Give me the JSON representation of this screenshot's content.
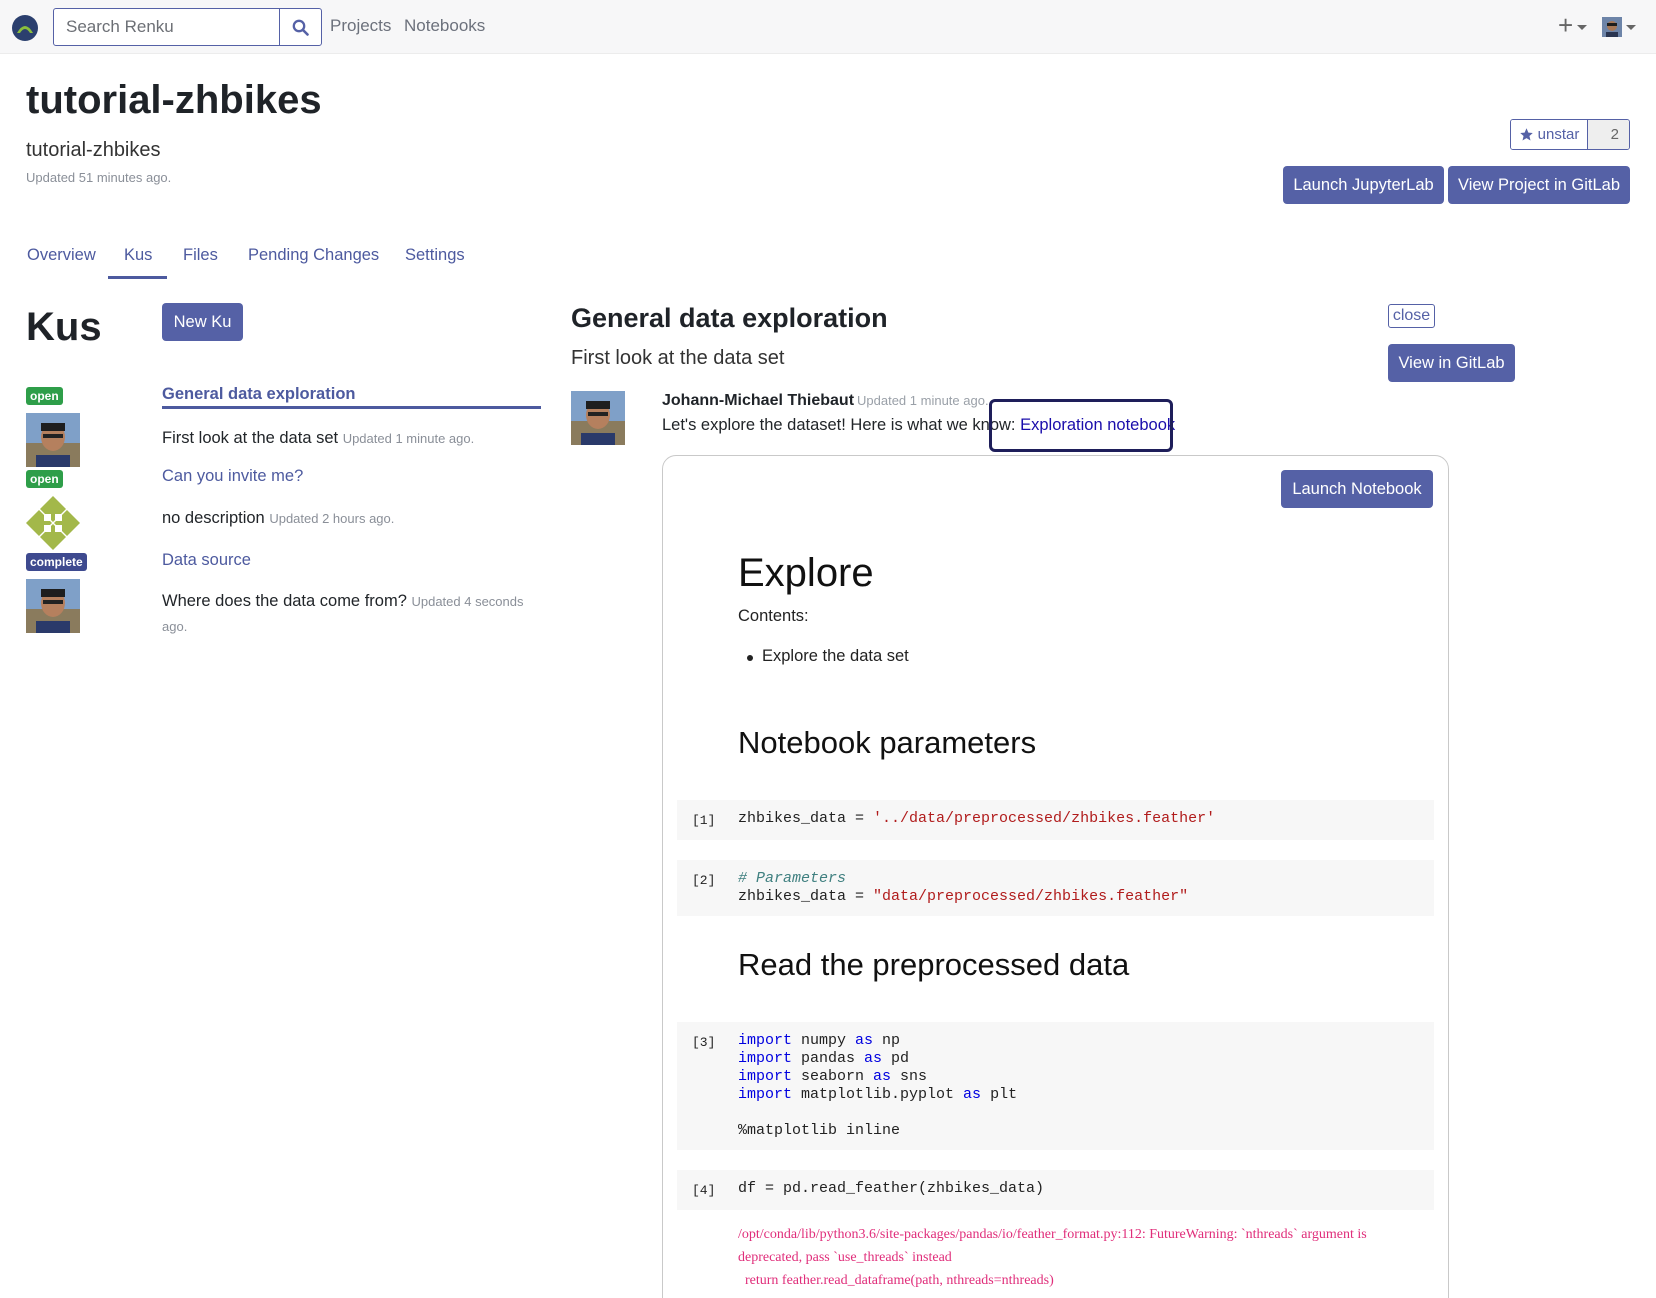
{
  "nav": {
    "search_placeholder": "Search Renku",
    "links": [
      "Projects",
      "Notebooks"
    ],
    "plus_label": "+"
  },
  "project": {
    "title": "tutorial-zhbikes",
    "subtitle": "tutorial-zhbikes",
    "updated": "Updated 51 minutes ago.",
    "star_label": "unstar",
    "star_count": "2",
    "launch_jupyterlab": "Launch JupyterLab",
    "view_in_gitlab": "View Project in GitLab"
  },
  "tabs": [
    "Overview",
    "Kus",
    "Files",
    "Pending Changes",
    "Settings"
  ],
  "kus": {
    "heading": "Kus",
    "new_button": "New Ku",
    "items": [
      {
        "status": "open",
        "title": "General data exploration",
        "desc": "First look at the data set",
        "updated": "Updated 1 minute ago."
      },
      {
        "status": "open",
        "title": "Can you invite me?",
        "desc": "no description",
        "updated": "Updated 2 hours ago."
      },
      {
        "status": "complete",
        "title": "Data source",
        "desc": "Where does the data come from?",
        "updated": "Updated 4 seconds ago."
      }
    ]
  },
  "detail": {
    "title": "General data exploration",
    "subtitle": "First look at the data set",
    "close_label": "close",
    "view_gitlab": "View in GitLab",
    "author": "Johann-Michael Thiebaut",
    "author_updated": "Updated 1 minute ago.",
    "comment_text": "Let's explore the dataset! Here is what we know: ",
    "comment_link": "Exploration notebook"
  },
  "notebook": {
    "launch_label": "Launch Notebook",
    "h_explore": "Explore",
    "contents_label": "Contents:",
    "bullet": "Explore the data set",
    "h_params": "Notebook parameters",
    "h_read": "Read the preprocessed data",
    "cells": [
      {
        "num": "[1]"
      },
      {
        "num": "[2]"
      },
      {
        "num": "[3]"
      },
      {
        "num": "[4]"
      }
    ],
    "cell1": {
      "var": "zhbikes_data = ",
      "str": "'../data/preprocessed/zhbikes.feather'"
    },
    "cell2": {
      "comment": "# Parameters",
      "var": "zhbikes_data = ",
      "str": "\"data/preprocessed/zhbikes.feather\""
    },
    "cell3": {
      "kw_import": "import",
      "kw_as": "as",
      "l1": " numpy ",
      "l1b": " np",
      "l2": " pandas ",
      "l2b": " pd",
      "l3": " seaborn ",
      "l3b": " sns",
      "l4": " matplotlib.pyplot ",
      "l4b": " plt",
      "magic": "%matplotlib inline"
    },
    "cell4": {
      "code": "df = pd.read_feather(zhbikes_data)"
    },
    "warning": [
      "/opt/conda/lib/python3.6/site-packages/pandas/io/feather_format.py:112: FutureWarning: `nthreads` argument is",
      "deprecated, pass `use_threads` instead",
      "  return feather.read_dataframe(path, nthreads=nthreads)"
    ]
  }
}
